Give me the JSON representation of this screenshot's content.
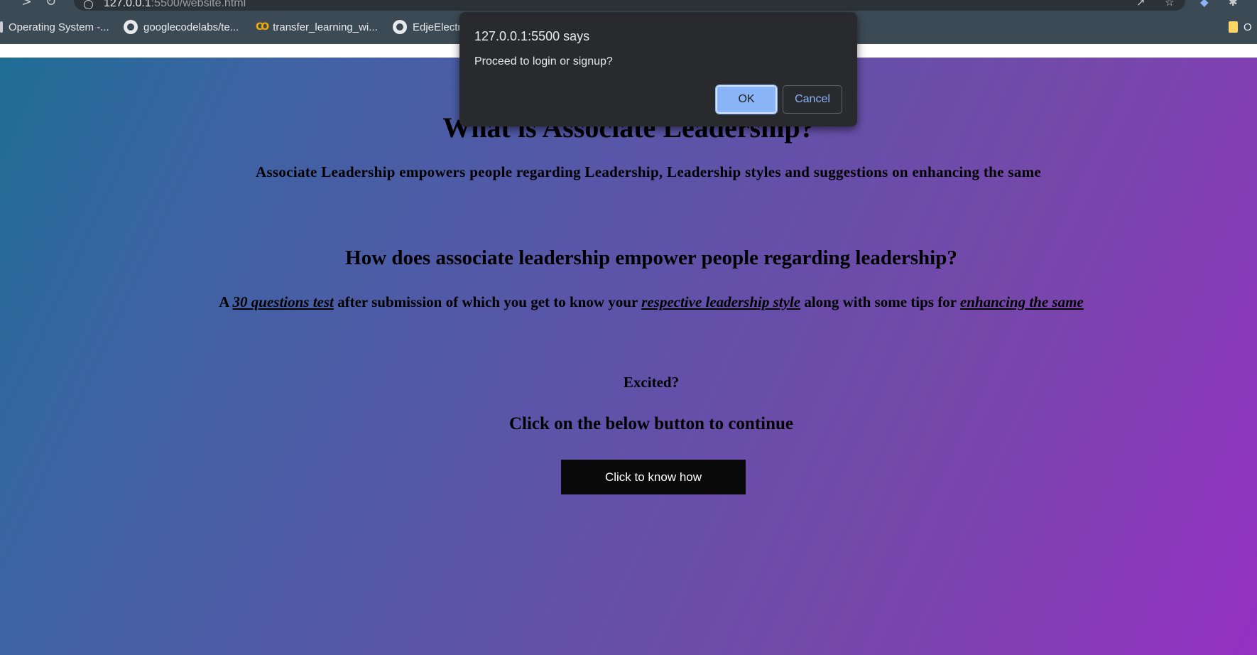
{
  "browser": {
    "url_host": "127.0.0.1",
    "url_rest": ":5500/website.html",
    "bookmarks": [
      {
        "label": "Operating System -...",
        "icon": "bookmark-icon"
      },
      {
        "label": "googlecodelabs/te...",
        "icon": "github-icon"
      },
      {
        "label": "transfer_learning_wi...",
        "icon": "colab-icon"
      },
      {
        "label": "EdjeElectr",
        "icon": "github-icon"
      },
      {
        "label": "O",
        "icon": "folder-icon"
      }
    ]
  },
  "dialog": {
    "title": "127.0.0.1:5500 says",
    "message": "Proceed to login or signup?",
    "ok_label": "OK",
    "cancel_label": "Cancel"
  },
  "page": {
    "heading": "What is Associate Leadership?",
    "intro": "Associate Leadership empowers people regarding Leadership, Leadership styles and suggestions on enhancing the same",
    "subheading": "How does associate leadership empower people regarding leadership?",
    "desc_part1": "A ",
    "desc_link1": "30 questions test",
    "desc_part2": " after submission of which you get to know your ",
    "desc_link2": "respective leadership style",
    "desc_part3": " along with some tips for ",
    "desc_link3": "enhancing the same",
    "excited": "Excited?",
    "continue_text": "Click on the below button to continue",
    "cta_label": "Click to know how"
  },
  "colors": {
    "gradient_start": "#1f6e96",
    "gradient_end": "#9430c2",
    "dialog_bg": "#292a2d",
    "ok_button": "#8ab4f8"
  }
}
